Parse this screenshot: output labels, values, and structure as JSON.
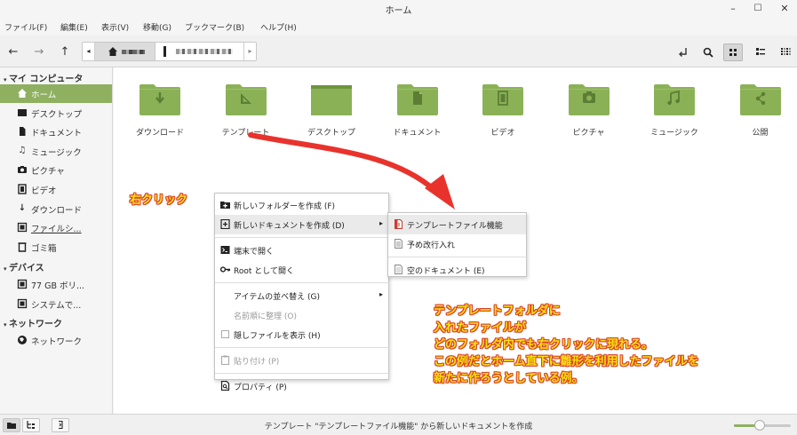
{
  "window": {
    "title": "ホーム",
    "controls": {
      "minimize": "–",
      "maximize": "☐",
      "close": "✕"
    }
  },
  "menubar": [
    "ファイル(F)",
    "編集(E)",
    "表示(V)",
    "移動(G)",
    "ブックマーク(B)",
    "ヘルプ(H)"
  ],
  "toolbar": {
    "back_icon": "←",
    "forward_icon": "→",
    "up_icon": "↑",
    "path_left_arrow": "◂",
    "path_right_arrow": "▸",
    "view_icons": [
      "icon-view-icon",
      "list-view-icon",
      "compact-view-icon"
    ]
  },
  "sidebar": {
    "sections": [
      {
        "title": "マイ コンピュータ",
        "items": [
          {
            "label": "ホーム",
            "icon": "home-icon",
            "active": true
          },
          {
            "label": "デスクトップ",
            "icon": "desktop-icon"
          },
          {
            "label": "ドキュメント",
            "icon": "document-icon"
          },
          {
            "label": "ミュージック",
            "icon": "music-icon"
          },
          {
            "label": "ピクチャ",
            "icon": "camera-icon"
          },
          {
            "label": "ビデオ",
            "icon": "video-icon"
          },
          {
            "label": "ダウンロード",
            "icon": "download-icon"
          },
          {
            "label": "ファイルシ...",
            "icon": "filesystem-icon"
          },
          {
            "label": "ゴミ箱",
            "icon": "trash-icon"
          }
        ]
      },
      {
        "title": "デバイス",
        "items": [
          {
            "label": "77 GB ボリ...",
            "icon": "drive-icon"
          },
          {
            "label": "システムで...",
            "icon": "drive-icon"
          }
        ]
      },
      {
        "title": "ネットワーク",
        "items": [
          {
            "label": "ネットワーク",
            "icon": "network-icon"
          }
        ]
      }
    ]
  },
  "folders": [
    {
      "label": "ダウンロード",
      "emblem": "download"
    },
    {
      "label": "テンプレート",
      "emblem": "template"
    },
    {
      "label": "デスクトップ",
      "emblem": "desktop"
    },
    {
      "label": "ドキュメント",
      "emblem": "document"
    },
    {
      "label": "ビデオ",
      "emblem": "video"
    },
    {
      "label": "ピクチャ",
      "emblem": "picture"
    },
    {
      "label": "ミュージック",
      "emblem": "music"
    },
    {
      "label": "公開",
      "emblem": "share"
    }
  ],
  "context_menu": {
    "items": [
      {
        "label": "新しいフォルダーを作成 (F)",
        "icon": "new-folder-icon"
      },
      {
        "label": "新しいドキュメントを作成 (D)",
        "icon": "new-document-icon",
        "submenu": "▸",
        "highlighted": true
      },
      {
        "separator": true
      },
      {
        "label": "端末で開く",
        "icon": "terminal-icon"
      },
      {
        "label": "Root として開く",
        "icon": "key-icon"
      },
      {
        "separator": true
      },
      {
        "label": "アイテムの並べ替え (G)",
        "submenu": "▸"
      },
      {
        "label": "名前順に整理 (O)",
        "disabled": true
      },
      {
        "label": "隠しファイルを表示 (H)",
        "checkbox": true
      },
      {
        "separator": true
      },
      {
        "label": "貼り付け (P)",
        "icon": "paste-icon",
        "disabled": true
      },
      {
        "separator": true
      },
      {
        "label": "プロパティ (P)",
        "icon": "properties-icon"
      }
    ]
  },
  "submenu": {
    "items": [
      {
        "label": "テンプレートファイル機能",
        "icon": "template-file-icon",
        "highlighted": true
      },
      {
        "label": "予め改行入れ",
        "icon": "text-file-icon"
      },
      {
        "separator": true
      },
      {
        "label": "空のドキュメント (E)",
        "icon": "empty-document-icon"
      }
    ]
  },
  "annotations": {
    "right_click": "右クリック",
    "explanation": [
      "テンプレートフォルダに",
      "入れたファイルが",
      "どのフォルダ内でも右クリックに現れる。",
      "この例だとホーム直下に雛形を利用したファイルを",
      "新たに作ろうとしている例。"
    ]
  },
  "statusbar": {
    "text": "テンプレート \"テンプレートファイル機能\" から新しいドキュメントを作成",
    "zoom_level": 0.45
  },
  "colors": {
    "accent": "#8fb061",
    "folder": "#8bb157",
    "folder_dark": "#6f9440",
    "annotation_text": "#f8e10f",
    "annotation_outline": "#d9402a",
    "arrow": "#e8332c"
  }
}
